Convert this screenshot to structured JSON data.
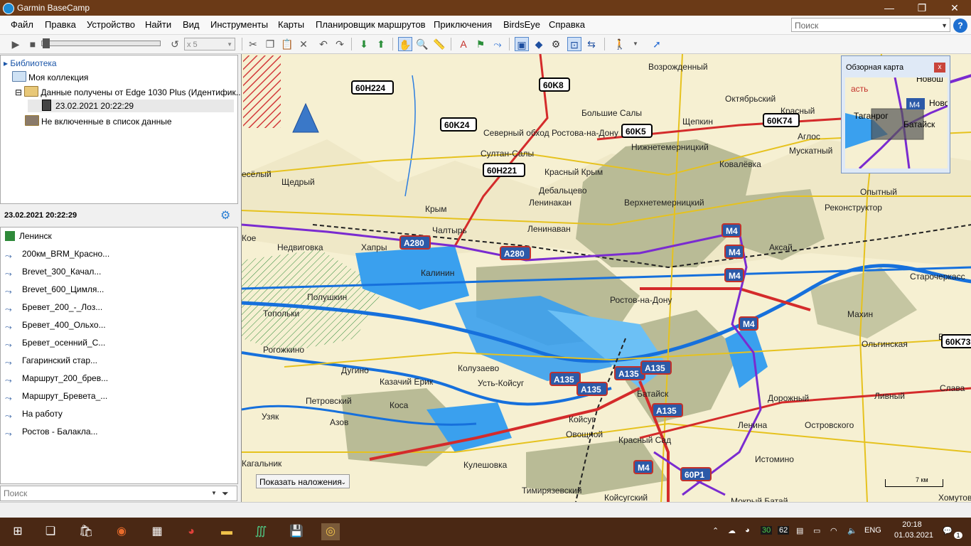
{
  "window": {
    "title": "Garmin BaseCamp"
  },
  "menu": [
    "Файл",
    "Правка",
    "Устройство",
    "Найти",
    "Вид",
    "Инструменты",
    "Карты",
    "Планировщик маршрутов",
    "Приключения",
    "BirdsEye",
    "Справка"
  ],
  "search": {
    "placeholder": "Поиск"
  },
  "toolbar": {
    "speed_label": "x 5"
  },
  "library": {
    "header": "Библиотека",
    "my_collection": "Моя коллекция",
    "device_data": "Данные получены от Edge 1030 Plus (Идентифик...",
    "session": "23.02.2021 20:22:29",
    "unlisted": "Не включенные в список данные"
  },
  "info": {
    "title": "23.02.2021 20:22:29",
    "items": [
      "Ленинск",
      "200км_BRM_Красно...",
      "Brevet_300_Качал...",
      "Brevet_600_Цимля...",
      "Бревет_200_-_Лоз...",
      "Бревет_400_Ольхо...",
      "Бревет_осенний_С...",
      "Гагаринский стар...",
      "Маршрут_200_брев...",
      "Маршрут_Бревета_...",
      "На работу",
      "Ростов - Балакла..."
    ]
  },
  "left_search": {
    "placeholder": "Поиск"
  },
  "map": {
    "overlay_button": "Показать наложения",
    "scale": "7 км",
    "towns": [
      {
        "name": "Возрожденный"
      },
      {
        "name": "Октябрьский"
      },
      {
        "name": "Красный"
      },
      {
        "name": "Большие Салы"
      },
      {
        "name": "Щепкин"
      },
      {
        "name": "Северный обход Ростова-на-Дону"
      },
      {
        "name": "Аглос"
      },
      {
        "name": "Мускатный"
      },
      {
        "name": "Нижнетемерницкий"
      },
      {
        "name": "Ковалёвка"
      },
      {
        "name": "Султан-Салы"
      },
      {
        "name": "Красный Крым"
      },
      {
        "name": "Дебальцево"
      },
      {
        "name": "Ленинакан"
      },
      {
        "name": "Верхнетемерницкий"
      },
      {
        "name": "Щедрый"
      },
      {
        "name": "Крым"
      },
      {
        "name": "Чалтырь"
      },
      {
        "name": "Опытный"
      },
      {
        "name": "Реконструктор"
      },
      {
        "name": "Ленинаван"
      },
      {
        "name": "Недвиговка"
      },
      {
        "name": "Хапры"
      },
      {
        "name": "Аксай"
      },
      {
        "name": "Калинин"
      },
      {
        "name": "Ростов-на-Дону"
      },
      {
        "name": "Старочеркасс"
      },
      {
        "name": "Полушкин"
      },
      {
        "name": "Топольки"
      },
      {
        "name": "Махин"
      },
      {
        "name": "Верхн"
      },
      {
        "name": "Ольгинская"
      },
      {
        "name": "Рогожкино"
      },
      {
        "name": "Колузаево"
      },
      {
        "name": "Усть-Койсуг"
      },
      {
        "name": "Казачий Ерик"
      },
      {
        "name": "Батайск"
      },
      {
        "name": "Дорожный"
      },
      {
        "name": "Ливный"
      },
      {
        "name": "Слава"
      },
      {
        "name": "Петровский"
      },
      {
        "name": "Коса"
      },
      {
        "name": "Узяк"
      },
      {
        "name": "Азов"
      },
      {
        "name": "Койсуг"
      },
      {
        "name": "Овощной"
      },
      {
        "name": "Ленина"
      },
      {
        "name": "Островского"
      },
      {
        "name": "Красный Сад"
      },
      {
        "name": "Кулешовка"
      },
      {
        "name": "Истомино"
      },
      {
        "name": "Кагальник"
      },
      {
        "name": "Тимирязевский"
      },
      {
        "name": "Койсугский"
      },
      {
        "name": "Мокрый Батай"
      },
      {
        "name": "Хомутов"
      },
      {
        "name": "Дугино"
      },
      {
        "name": "есёлый"
      },
      {
        "name": "Кое"
      }
    ],
    "shields": [
      {
        "label": "60Н224",
        "kind": "white"
      },
      {
        "label": "60K8",
        "kind": "white"
      },
      {
        "label": "60K24",
        "kind": "white"
      },
      {
        "label": "60K5",
        "kind": "white"
      },
      {
        "label": "60K74",
        "kind": "white"
      },
      {
        "label": "60Н221",
        "kind": "white"
      },
      {
        "label": "A280",
        "kind": "blue"
      },
      {
        "label": "A280",
        "kind": "blue"
      },
      {
        "label": "M4",
        "kind": "blue"
      },
      {
        "label": "M4",
        "kind": "blue"
      },
      {
        "label": "M4",
        "kind": "blue"
      },
      {
        "label": "M4",
        "kind": "blue"
      },
      {
        "label": "A135",
        "kind": "blue"
      },
      {
        "label": "A135",
        "kind": "blue"
      },
      {
        "label": "A135",
        "kind": "blue"
      },
      {
        "label": "A135",
        "kind": "blue"
      },
      {
        "label": "A135",
        "kind": "blue"
      },
      {
        "label": "M4",
        "kind": "blue"
      },
      {
        "label": "60Р1",
        "kind": "blue"
      },
      {
        "label": "60K73",
        "kind": "white"
      }
    ]
  },
  "overview": {
    "title": "Обзорная карта",
    "close": "x",
    "labels": [
      {
        "text": "асть"
      },
      {
        "text": "Таганрог"
      },
      {
        "text": "Батайск"
      },
      {
        "text": "Ново"
      },
      {
        "text": "Новош"
      },
      {
        "text": "М4"
      }
    ]
  },
  "taskbar": {
    "time": "20:18",
    "date": "01.03.2021",
    "lang": "ENG",
    "tray_num_1": "30",
    "tray_num_2": "62",
    "notif_count": "1"
  },
  "colors": {
    "titlebar": "#6b3a17",
    "taskbar": "#4a2814",
    "map_land": "#f6f0d2",
    "urban": "#b9bb96",
    "water": "#3aa0ee",
    "motorway": "#d42b2b",
    "route_purple": "#7a2bd0"
  }
}
